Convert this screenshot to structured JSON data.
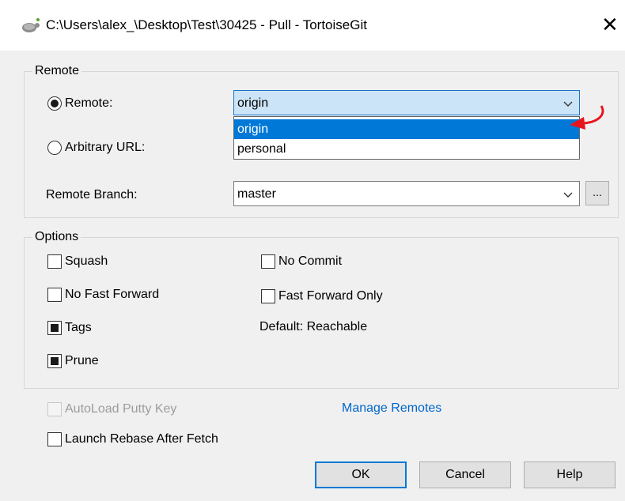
{
  "window": {
    "title": "C:\\Users\\alex_\\Desktop\\Test\\30425 - Pull - TortoiseGit",
    "close_symbol": "✕"
  },
  "remote_group": {
    "legend": "Remote",
    "remote_radio_label": "Remote:",
    "remote_selected": "origin",
    "remote_options": [
      "origin",
      "personal"
    ],
    "arbitrary_radio_label": "Arbitrary URL:",
    "branch_label": "Remote Branch:",
    "branch_value": "master",
    "browse_label": "..."
  },
  "options_group": {
    "legend": "Options",
    "squash": "Squash",
    "no_commit": "No Commit",
    "no_fast_forward": "No Fast Forward",
    "fast_forward_only": "Fast Forward Only",
    "tags": "Tags",
    "default_reachable": "Default: Reachable",
    "prune": "Prune"
  },
  "bottom": {
    "autoload_putty": "AutoLoad Putty Key",
    "manage_remotes": "Manage Remotes",
    "launch_rebase": "Launch Rebase After Fetch",
    "ok": "OK",
    "cancel": "Cancel",
    "help": "Help"
  },
  "colors": {
    "accent": "#0078d7",
    "annotation_arrow": "#e8141c",
    "link": "#0066cc"
  }
}
